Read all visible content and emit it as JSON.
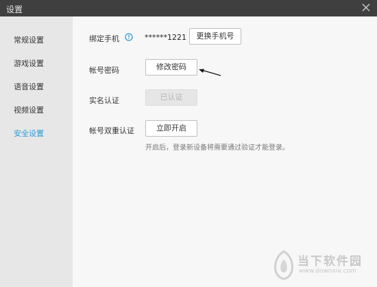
{
  "window": {
    "title": "设置"
  },
  "sidebar": {
    "items": [
      {
        "label": "常规设置",
        "active": false
      },
      {
        "label": "游戏设置",
        "active": false
      },
      {
        "label": "语音设置",
        "active": false
      },
      {
        "label": "视频设置",
        "active": false
      },
      {
        "label": "安全设置",
        "active": true
      }
    ]
  },
  "security": {
    "bind_phone": {
      "label": "绑定手机",
      "number": "******1221",
      "button": "更换手机号",
      "info_icon": "info-circle-icon"
    },
    "password": {
      "label": "帐号密码",
      "button": "修改密码"
    },
    "realname": {
      "label": "实名认证",
      "button": "已认证"
    },
    "two_factor": {
      "label": "帐号双重认证",
      "button": "立即开启",
      "hint": "开启后，登录新设备将需要通过验证才能登录。"
    }
  },
  "watermark": {
    "text": "当下软件园",
    "url": "www.downxia.com"
  },
  "colors": {
    "accent": "#2d9ad8",
    "titlebar": "#3f3f3f",
    "sidebar": "#e7e7e7",
    "content": "#f7f7f7"
  }
}
